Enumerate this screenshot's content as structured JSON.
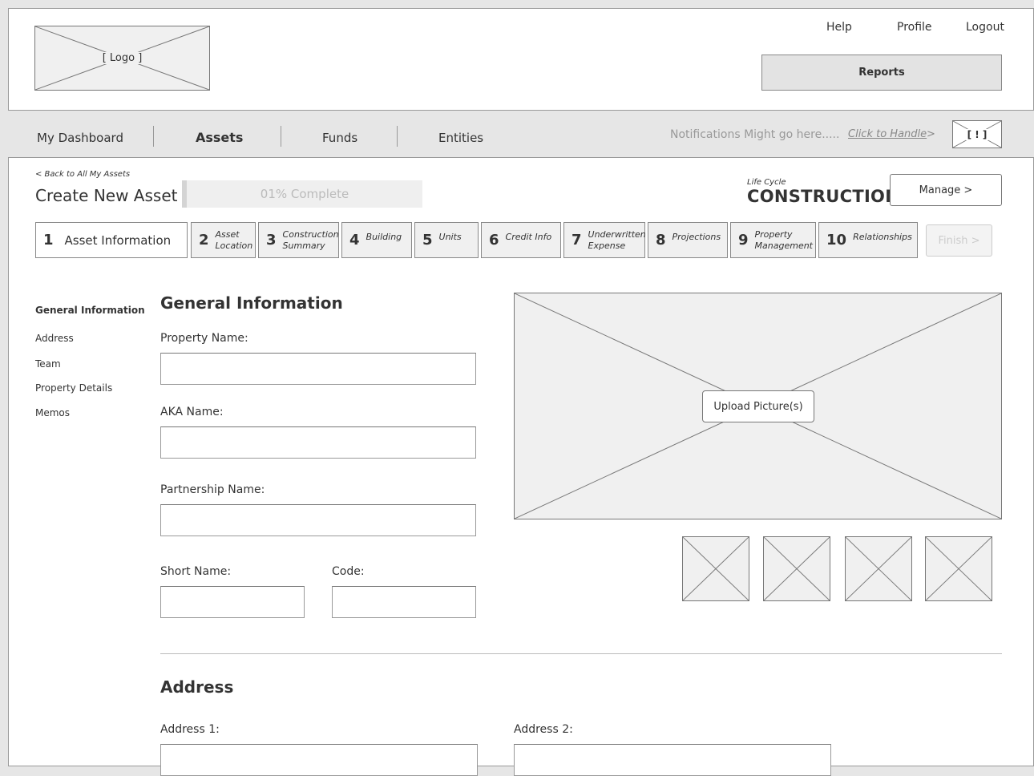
{
  "header": {
    "logo_text": "[ Logo ]",
    "links": {
      "help": "Help",
      "profile": "Profile",
      "logout": "Logout"
    },
    "reports_label": "Reports"
  },
  "nav": {
    "items": [
      "My Dashboard",
      "Assets",
      "Funds",
      "Entities"
    ],
    "active": "Assets",
    "notification_text": "Notifications Might go here.....",
    "handle_link": "Click to Handle",
    "handle_arrow": ">",
    "alert_icon_text": "[ ! ]"
  },
  "page": {
    "back_link": "< Back to All My Assets",
    "title": "Create New Asset",
    "progress_text": "01% Complete",
    "progress_percent": 1,
    "lifecycle_label": "Life Cycle",
    "lifecycle_value": "CONSTRUCTION",
    "manage_button": "Manage >",
    "finish_button": "Finish >"
  },
  "steps": [
    {
      "num": "1",
      "label_lines": [
        "Asset Information"
      ],
      "active": true
    },
    {
      "num": "2",
      "label_lines": [
        "Asset",
        "Location"
      ]
    },
    {
      "num": "3",
      "label_lines": [
        "Construction",
        "Summary"
      ]
    },
    {
      "num": "4",
      "label_lines": [
        "Building"
      ]
    },
    {
      "num": "5",
      "label_lines": [
        "Units"
      ]
    },
    {
      "num": "6",
      "label_lines": [
        "Credit Info"
      ]
    },
    {
      "num": "7",
      "label_lines": [
        "Underwritten",
        "Expense"
      ]
    },
    {
      "num": "8",
      "label_lines": [
        "Projections"
      ]
    },
    {
      "num": "9",
      "label_lines": [
        "Property",
        "Management"
      ]
    },
    {
      "num": "10",
      "label_lines": [
        "Relationships"
      ]
    }
  ],
  "sidenav": {
    "items": [
      "General Information",
      "Address",
      "Team",
      "Property Details",
      "Memos"
    ],
    "active": "General Information"
  },
  "general": {
    "heading": "General Information",
    "property_name_label": "Property Name:",
    "property_name_value": "",
    "aka_name_label": "AKA Name:",
    "aka_name_value": "",
    "partnership_name_label": "Partnership Name:",
    "partnership_name_value": "",
    "short_name_label": "Short Name:",
    "short_name_value": "",
    "code_label": "Code:",
    "code_value": ""
  },
  "media": {
    "upload_button": "Upload Picture(s)",
    "thumbnail_count": 4
  },
  "address": {
    "heading": "Address",
    "address1_label": "Address 1:",
    "address1_value": "",
    "address2_label": "Address 2:",
    "address2_value": ""
  }
}
